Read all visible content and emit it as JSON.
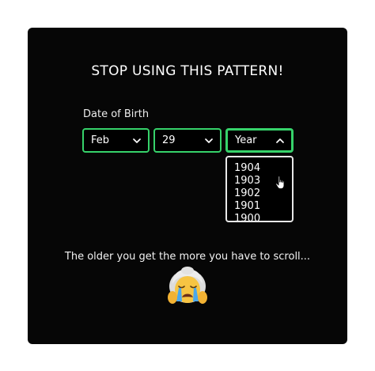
{
  "title": "STOP USING THIS PATTERN!",
  "dob_label": "Date of Birth",
  "month_select": {
    "value": "Feb"
  },
  "day_select": {
    "value": "29"
  },
  "year_select": {
    "value": "Year"
  },
  "year_options": [
    "1904",
    "1903",
    "1902",
    "1901",
    "1900"
  ],
  "caption": "The older you get the more you have to scroll...",
  "colors": {
    "card_background": "#060606",
    "accent_border": "#36d26a",
    "dropdown_border": "#e8e8e8",
    "text": "#ffffff"
  },
  "icons": {
    "select_chevron": "chevron-down-icon",
    "open_chevron": "chevron-up-icon",
    "cursor": "hand-pointer-icon",
    "emoji": "crying-old-woman-emoji"
  }
}
